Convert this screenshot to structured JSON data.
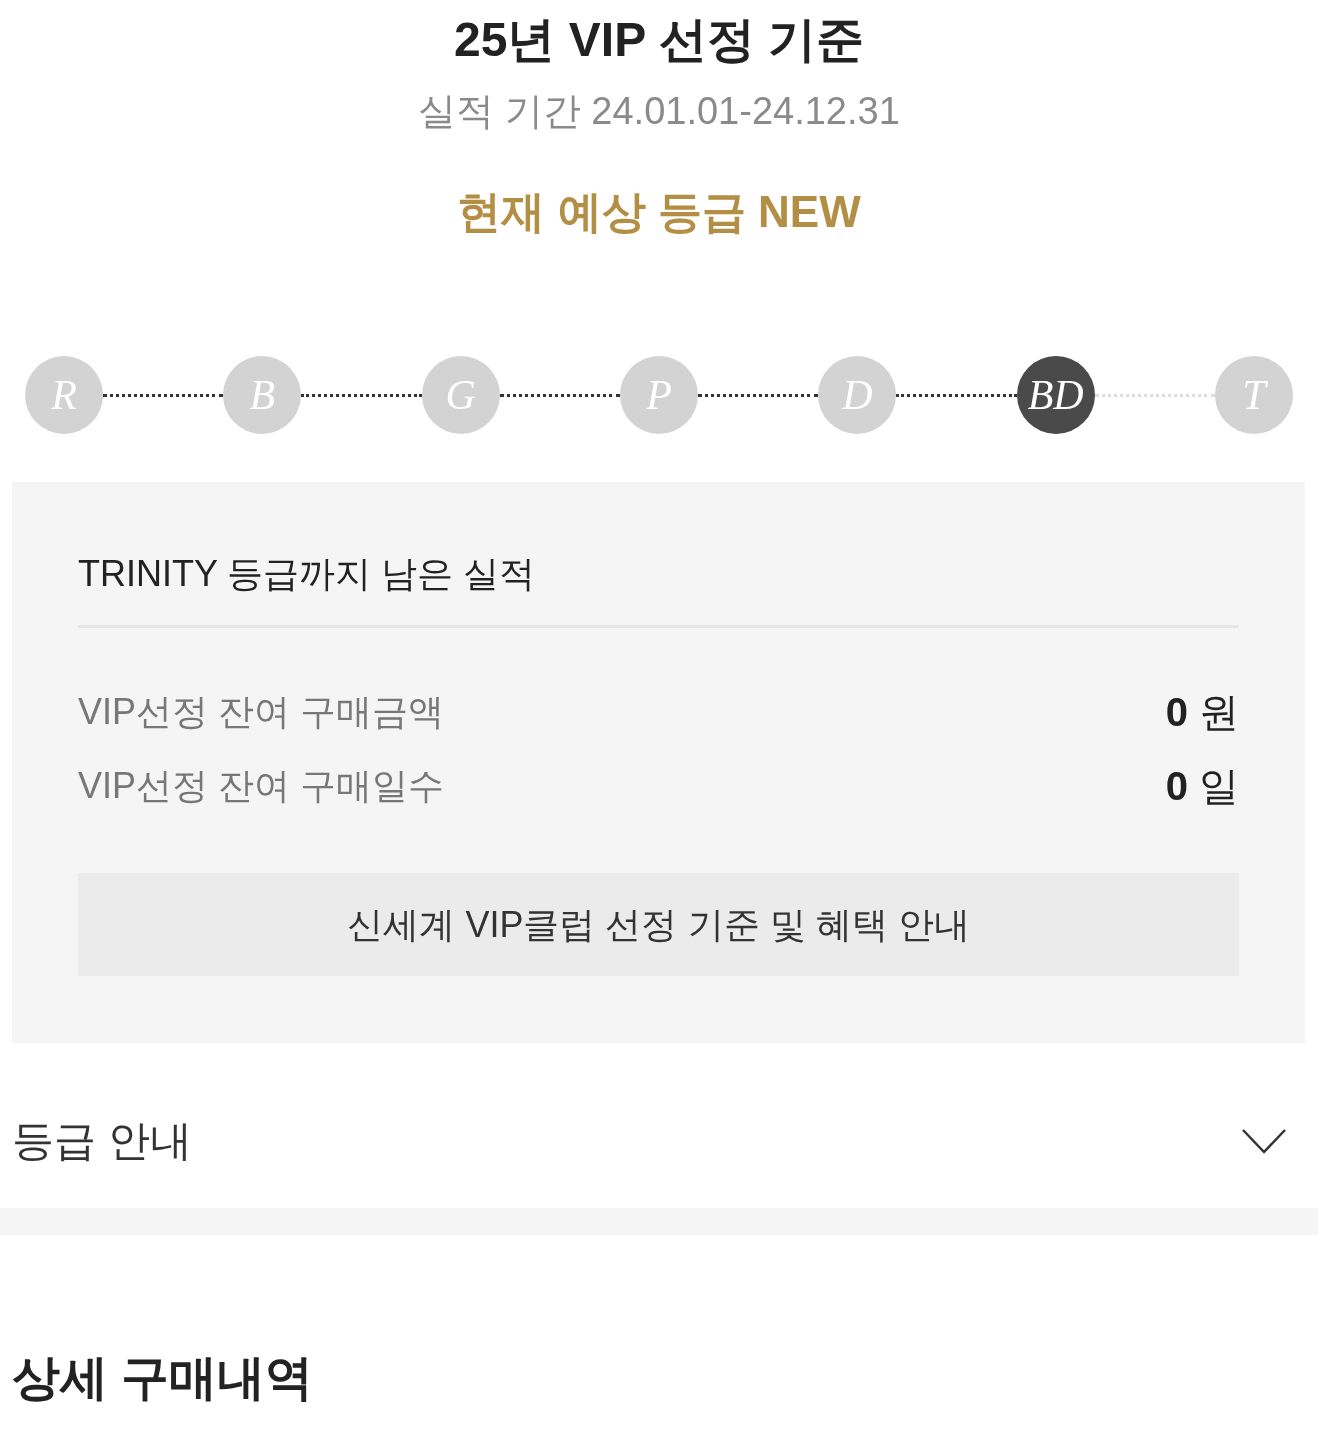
{
  "header": {
    "title": "25년 VIP 선정 기준",
    "period": "실적 기간 24.01.01-24.12.31",
    "expected_grade": "현재 예상 등급 NEW"
  },
  "grades": [
    {
      "label": "R",
      "selected": false
    },
    {
      "label": "B",
      "selected": false
    },
    {
      "label": "G",
      "selected": false
    },
    {
      "label": "P",
      "selected": false
    },
    {
      "label": "D",
      "selected": false
    },
    {
      "label": "BD",
      "selected": true
    },
    {
      "label": "T",
      "selected": false
    }
  ],
  "remaining_card": {
    "title": "TRINITY 등급까지 남은 실적",
    "rows": [
      {
        "label": "VIP선정 잔여 구매금액",
        "value": "**0** 원"
      },
      {
        "label": "VIP선정 잔여 구매일수",
        "value": "**0** 일"
      }
    ],
    "button": "신세계 VIP클럽 선정 기준 및 혜택 안내"
  },
  "grade_guide": {
    "label": "등급 안내",
    "expanded": false
  },
  "section_title": "상세 구매내역"
}
